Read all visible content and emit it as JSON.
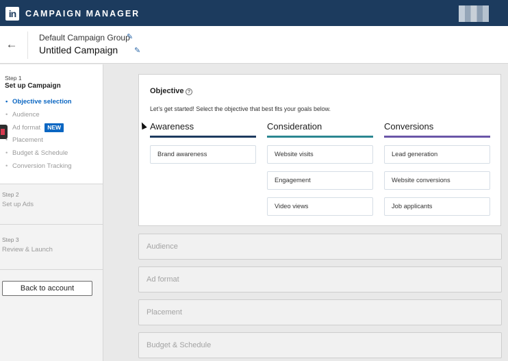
{
  "topbar": {
    "logo_text": "in",
    "app_title": "CAMPAIGN MANAGER"
  },
  "header": {
    "back_icon": "arrow-left-icon",
    "group_name": "Default Campaign Group",
    "campaign_name": "Untitled Campaign",
    "edit_icon": "pencil-icon"
  },
  "sidebar": {
    "step1": {
      "number": "Step 1",
      "title": "Set up Campaign",
      "items": [
        {
          "label": "Objective selection",
          "active": true
        },
        {
          "label": "Audience",
          "active": false
        },
        {
          "label": "Ad format",
          "badge": "NEW",
          "active": false
        },
        {
          "label": "Placement",
          "active": false
        },
        {
          "label": "Budget & Schedule",
          "active": false
        },
        {
          "label": "Conversion Tracking",
          "active": false
        }
      ]
    },
    "step2": {
      "number": "Step 2",
      "title": "Set up Ads"
    },
    "step3": {
      "number": "Step 3",
      "title": "Review & Launch"
    },
    "back_button": "Back to account"
  },
  "objective": {
    "title": "Objective",
    "help_icon": "question-circle-icon",
    "intro": "Let’s get started! Select the objective that best fits your goals below.",
    "columns": [
      {
        "heading": "Awareness",
        "color": "#1d3a5f",
        "options": [
          "Brand awareness"
        ]
      },
      {
        "heading": "Consideration",
        "color": "#2b8791",
        "options": [
          "Website visits",
          "Engagement",
          "Video views"
        ]
      },
      {
        "heading": "Conversions",
        "color": "#6a56a8",
        "options": [
          "Lead generation",
          "Website conversions",
          "Job applicants"
        ]
      }
    ]
  },
  "sections": [
    "Audience",
    "Ad format",
    "Placement",
    "Budget & Schedule"
  ]
}
